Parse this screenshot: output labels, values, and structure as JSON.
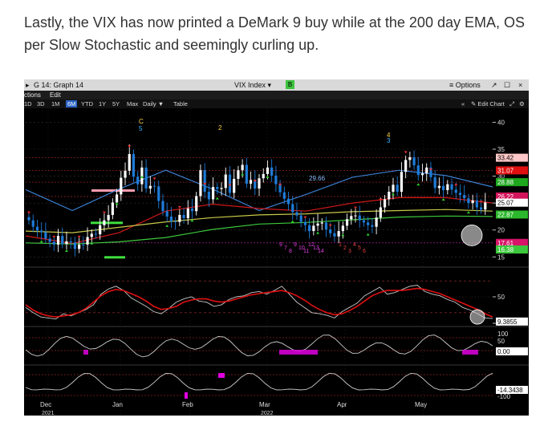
{
  "article": {
    "paragraph": "Lastly, the VIX has now printed a DeMark 9 buy while at the 200 day EMA, OS per Slow Stochastic and seemingly curling up."
  },
  "window": {
    "title_left": "G 14: Graph 14",
    "ticker": "VIX Index",
    "badge": "B",
    "options_label": "Options",
    "actions_label": "ctions",
    "edit_label": "Edit"
  },
  "toolbar": {
    "periods": [
      "1D",
      "3D",
      "1M",
      "6M",
      "YTD",
      "1Y",
      "5Y",
      "Max"
    ],
    "active_period": "6M",
    "frequency": "Daily",
    "table_label": "Table",
    "edit_chart_label": "Edit Chart"
  },
  "colors": {
    "bull_candle": "#ffffff",
    "bear_candle": "#1e7bd8",
    "ema_blue": "#3a7fd0",
    "ema_red": "#d01818",
    "ema_yellow": "#c8c84a",
    "ema_green": "#3cc83c",
    "stoch_fast": "#c8c8c8",
    "stoch_slow": "#e01010",
    "magenta": "#e000e0"
  },
  "chart_data": [
    {
      "type": "candlestick",
      "panel": "price",
      "ylim": [
        14,
        42
      ],
      "yticks": [
        15,
        20,
        25,
        30,
        35,
        40
      ],
      "x_months": [
        "Dec\n2021",
        "Jan",
        "Feb",
        "Mar\n2022",
        "Apr",
        "May"
      ],
      "closes": [
        21.8,
        20.6,
        19.9,
        19.6,
        18.4,
        17.8,
        17.3,
        18.9,
        17.4,
        17.9,
        17.7,
        16.5,
        17.3,
        17.3,
        18.7,
        19.3,
        19.2,
        20.9,
        21.8,
        22.8,
        25.1,
        26.6,
        29.7,
        31.0,
        34.1,
        29.9,
        28.5,
        31.6,
        27.7,
        28.2,
        28.1,
        25.4,
        23.5,
        22.5,
        21.6,
        21.5,
        22.8,
        22.2,
        24.0,
        23.5,
        26.3,
        31.1,
        27.1,
        25.7,
        28.0,
        27.6,
        27.8,
        30.3,
        26.9,
        29.5,
        31.1,
        32.1,
        28.6,
        29.3,
        27.7,
        29.6,
        30.4,
        31.6,
        30.1,
        28.5,
        27.0,
        25.8,
        24.8,
        23.3,
        22.7,
        21.5,
        20.9,
        19.8,
        20.8,
        21.2,
        21.4,
        20.1,
        19.4,
        18.8,
        19.8,
        20.8,
        22.0,
        22.6,
        22.7,
        21.8,
        21.4,
        20.9,
        20.6,
        22.3,
        24.2,
        25.7,
        27.1,
        28.4,
        27.1,
        30.8,
        33.0,
        33.5,
        32.0,
        30.2,
        30.5,
        31.6,
        29.8,
        27.8,
        28.2,
        27.4,
        28.5,
        27.5,
        26.9,
        26.5,
        25.9,
        25.0,
        25.5,
        24.2,
        23.8,
        25.1
      ],
      "ema_values": [
        {
          "name": "EMA blue",
          "values": [
            27.5,
            23.6,
            27.6,
            31.1,
            27.6,
            23.6,
            26.6,
            29.8,
            31.1,
            30.1,
            28.0
          ]
        },
        {
          "name": "EMA red",
          "values": [
            18.9,
            17.5,
            19.5,
            23.5,
            24.8,
            24.0,
            23.5,
            25.0,
            26.0,
            26.0,
            25.0
          ]
        },
        {
          "name": "200 EMA yellow",
          "values": [
            19.8,
            19.5,
            20.5,
            21.5,
            22.3,
            22.8,
            23.0,
            23.4,
            23.6,
            23.8,
            23.5
          ]
        },
        {
          "name": "EMA green",
          "values": [
            17.6,
            17.4,
            17.8,
            18.6,
            20.1,
            21.1,
            21.4,
            21.9,
            22.4,
            22.6,
            22.5
          ]
        }
      ],
      "price_labels": [
        {
          "text": "33.42",
          "value": 33.42,
          "color": "#ffc8c8"
        },
        {
          "text": "31.07",
          "value": 31.07,
          "color": "#e01010"
        },
        {
          "text": "28.88",
          "value": 28.88,
          "color": "#1ea81e"
        },
        {
          "text": "26.22",
          "value": 26.22,
          "color": "#d4145a"
        },
        {
          "text": "25.07",
          "value": 25.07,
          "color": "#ffffff"
        },
        {
          "text": "22.87",
          "value": 22.87,
          "color": "#2cb82c"
        },
        {
          "text": "17.61",
          "value": 17.61,
          "color": "#d81468"
        },
        {
          "text": "16.38",
          "value": 16.38,
          "color": "#3cc83c"
        }
      ],
      "annotation": "29.66",
      "demark_top": [
        "C",
        "5",
        "2",
        "3",
        "4",
        "3"
      ],
      "demark_bottom": [
        "9",
        "7",
        "8",
        "9",
        "10",
        "11",
        "12",
        "13",
        "14",
        "1",
        "2",
        "3",
        "4",
        "5",
        "6"
      ]
    },
    {
      "type": "line",
      "panel": "slow-stochastic",
      "ylim": [
        0,
        100
      ],
      "yticks": [
        0,
        50
      ],
      "label": "9.3855",
      "values_fast": [
        30,
        20,
        12,
        10,
        8,
        18,
        14,
        20,
        26,
        35,
        55,
        65,
        70,
        62,
        48,
        40,
        32,
        22,
        18,
        28,
        40,
        46,
        50,
        42,
        40,
        32,
        35,
        45,
        50,
        52,
        58,
        60,
        55,
        62,
        70,
        55,
        40,
        30,
        20,
        18,
        15,
        10,
        22,
        30,
        38,
        52,
        60,
        68,
        55,
        58,
        64,
        70,
        72,
        60,
        55,
        52,
        45,
        40,
        30,
        25,
        18,
        10,
        9
      ],
      "values_slow": [
        35,
        25,
        18,
        14,
        12,
        14,
        16,
        20,
        28,
        40,
        52,
        60,
        64,
        62,
        56,
        50,
        42,
        32,
        26,
        28,
        32,
        40,
        44,
        46,
        46,
        42,
        40,
        42,
        46,
        50,
        54,
        56,
        58,
        60,
        62,
        58,
        52,
        44,
        34,
        26,
        20,
        16,
        18,
        24,
        32,
        42,
        52,
        58,
        62,
        62,
        62,
        64,
        66,
        64,
        60,
        56,
        50,
        44,
        38,
        32,
        26,
        18,
        12
      ]
    },
    {
      "type": "line",
      "panel": "oscillator-1",
      "yticks": [
        100,
        50
      ],
      "label": "0.00"
    },
    {
      "type": "line",
      "panel": "oscillator-2",
      "yticks": [
        -100
      ],
      "label": "-14.3438"
    }
  ]
}
